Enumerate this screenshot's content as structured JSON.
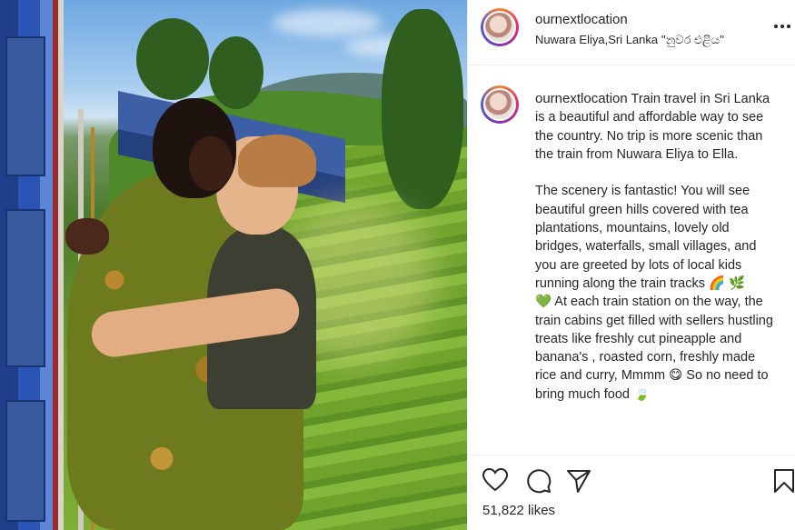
{
  "photo": {
    "alt": ""
  },
  "header": {
    "username": "ournextlocation",
    "location": "Nuwara Eliya,Sri Lanka ''නුවර එළිය''"
  },
  "caption": {
    "username": "ournextlocation",
    "text": " Train travel in Sri Lanka is a beautiful and affordable way to see the country. No trip is more scenic than the train from Nuwara Eliya to Ella.\n\nThe scenery is fantastic! You will see beautiful green hills covered with tea plantations, mountains, lovely old bridges, waterfalls, small villages, and you are greeted by lots of local kids running along the train tracks 🌈 🌿\n💚 At each train station on the way, the train cabins get filled with sellers hustling treats like freshly cut pineapple and banana's , roasted corn, freshly made rice and curry, Mmmm 😋 So no need to bring much food 🍃"
  },
  "actions": {
    "likes": "51,822 likes",
    "icons": [
      "heart-icon",
      "comment-icon",
      "share-icon",
      "bookmark-icon"
    ]
  },
  "colors": {
    "text": "#262626",
    "divider": "#efefef",
    "story_ring": [
      "#f58529",
      "#dd2a7b",
      "#8134af",
      "#515bd4"
    ]
  }
}
